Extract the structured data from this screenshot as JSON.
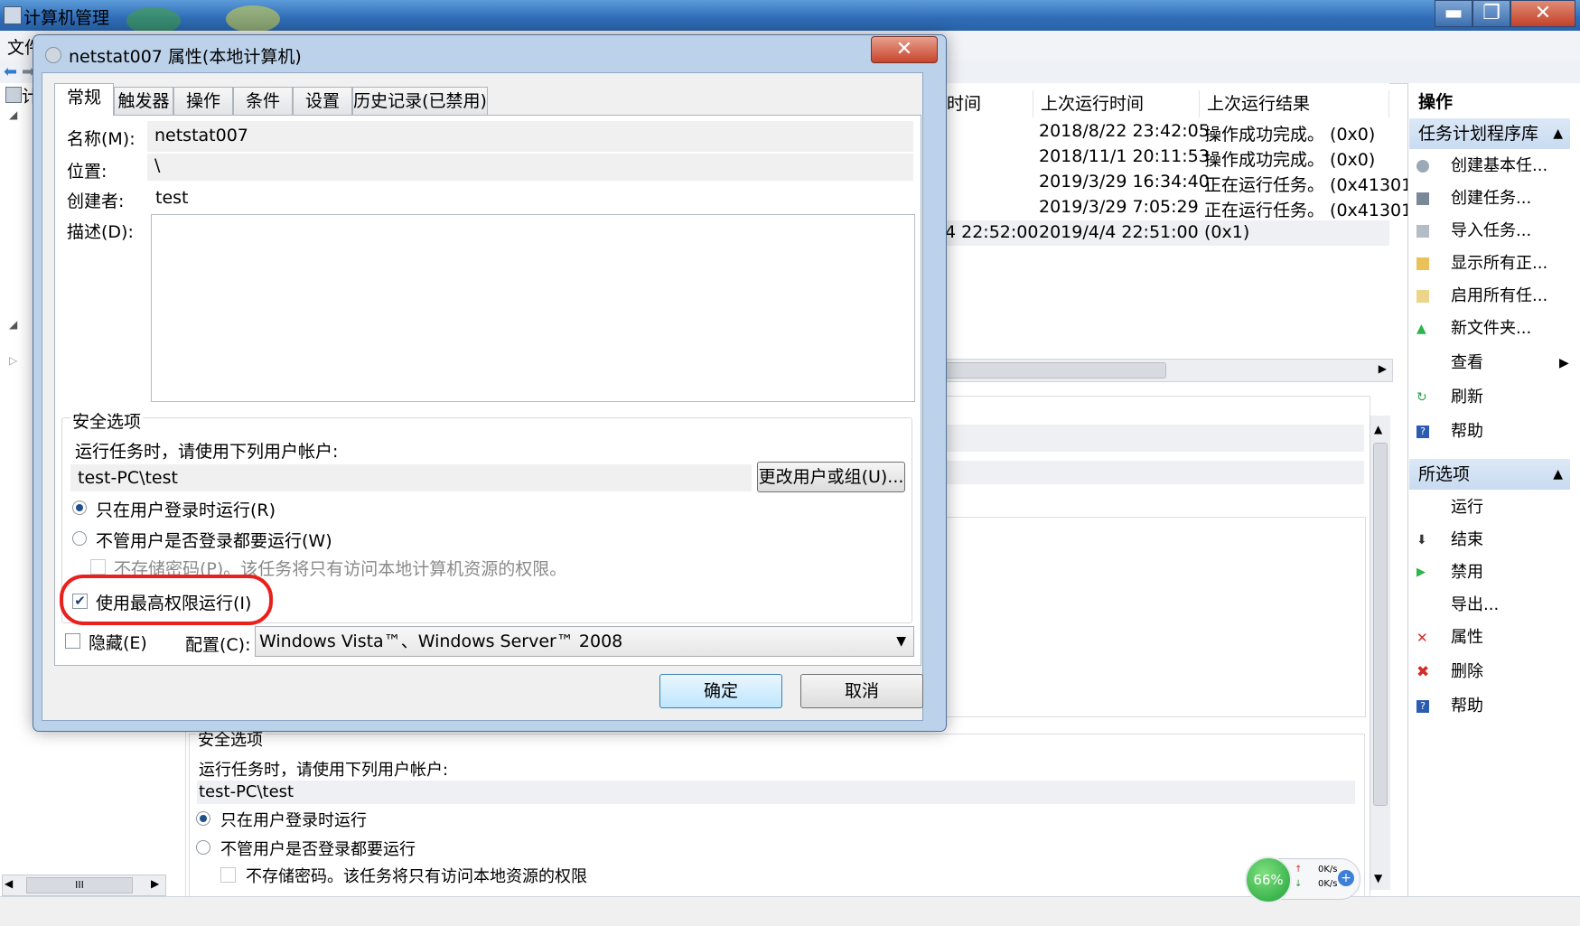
{
  "app": {
    "title": "计算机管理",
    "menu_first": "文件",
    "min_glyph": "▬",
    "max_glyph": "❐",
    "close_glyph": "✕"
  },
  "tree": {
    "item_top": "计",
    "hscroll_glyph": "III"
  },
  "list": {
    "columns": [
      "时间",
      "上次运行时间",
      "上次运行结果"
    ],
    "rows": [
      {
        "next": "",
        "last": "2018/8/22 23:42:05",
        "result": "操作成功完成。 (0x0)"
      },
      {
        "next": "",
        "last": "2018/11/1 20:11:53",
        "result": "操作成功完成。 (0x0)"
      },
      {
        "next": "",
        "last": "2019/3/29 16:34:40",
        "result": "正在运行任务。 (0x41301)"
      },
      {
        "next": "",
        "last": "2019/3/29 7:05:29",
        "result": "正在运行任务。 (0x41301)"
      },
      {
        "next": "4 22:52:00",
        "last": "2019/4/4 22:51:00",
        "result": "(0x1)"
      }
    ]
  },
  "detail": {
    "security_title": "安全选项",
    "run_as_label": "运行任务时，请使用下列用户帐户:",
    "user": "test-PC\\test",
    "opt_logged_on": "只在用户登录时运行",
    "opt_any": "不管用户是否登录都要运行",
    "opt_no_pwd": "不存储密码。该任务将只有访问本地资源的权限"
  },
  "actions": {
    "header": "操作",
    "section1": "任务计划程序库",
    "items1": [
      "创建基本任...",
      "创建任务...",
      "导入任务...",
      "显示所有正...",
      "启用所有任...",
      "新文件夹...",
      "查看",
      "刷新",
      "帮助"
    ],
    "section2": "所选项",
    "items2": [
      "运行",
      "结束",
      "禁用",
      "导出...",
      "属性",
      "删除",
      "帮助"
    ]
  },
  "netwidget": {
    "percent": "66%",
    "up": "0K/s",
    "down": "0K/s"
  },
  "dialog": {
    "title": "netstat007 属性(本地计算机)",
    "close_glyph": "✕",
    "tabs": [
      "常规",
      "触发器",
      "操作",
      "条件",
      "设置",
      "历史记录(已禁用)"
    ],
    "name_label": "名称(M):",
    "name_value": "netstat007",
    "location_label": "位置:",
    "location_value": "\\",
    "author_label": "创建者:",
    "author_value": "test",
    "desc_label": "描述(D):",
    "security_group": "安全选项",
    "run_as_label": "运行任务时，请使用下列用户帐户:",
    "user": "test-PC\\test",
    "change_user_button": "更改用户或组(U)...",
    "opt_logged_on": "只在用户登录时运行(R)",
    "opt_any": "不管用户是否登录都要运行(W)",
    "opt_no_pwd": "不存储密码(P)。该任务将只有访问本地计算机资源的权限。",
    "highest_priv": "使用最高权限运行(I)",
    "hidden": "隐藏(E)",
    "config_label": "配置(C):",
    "config_value": "Windows Vista™、Windows Server™ 2008",
    "ok_button": "确定",
    "cancel_button": "取消"
  },
  "colors": {
    "highlight": "#e8211d",
    "titlebar": "#2f6cb6",
    "section_header": "#c9dbf1"
  }
}
